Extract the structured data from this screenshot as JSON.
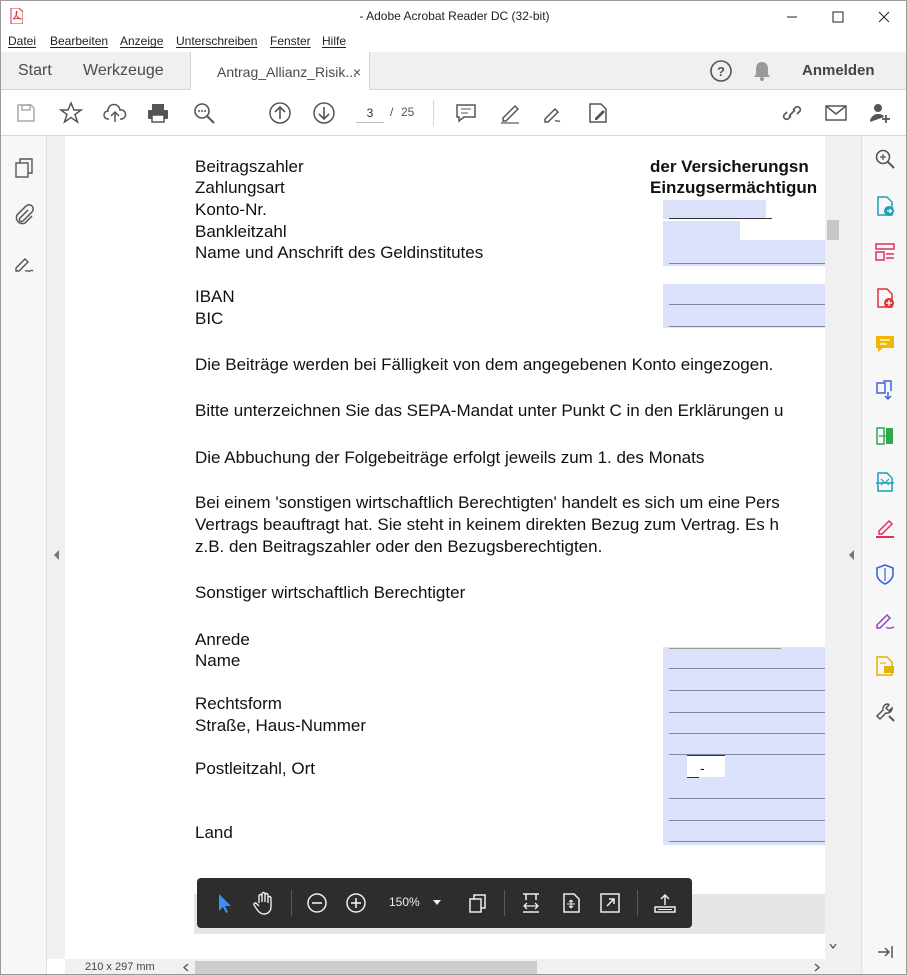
{
  "window": {
    "title": "- Adobe Acrobat Reader DC (32-bit)"
  },
  "menu": [
    "Datei",
    "Bearbeiten",
    "Anzeige",
    "Unterschreiben",
    "Fenster",
    "Hilfe"
  ],
  "tabs": {
    "start": "Start",
    "tools": "Werkzeuge",
    "document": "Antrag_Allianz_Risik...",
    "close": "×"
  },
  "header": {
    "signin": "Anmelden"
  },
  "toolbar": {
    "page_current": "3",
    "page_separator": "/",
    "page_total": "25"
  },
  "document": {
    "label_payer": "Beitragszahler",
    "label_payment_method": "Zahlungsart",
    "label_account": "Konto-Nr.",
    "label_bank_code": "Bankleitzahl",
    "label_bank_name": "Name und Anschrift des Geldinstitutes",
    "label_iban": "IBAN",
    "label_bic": "BIC",
    "value_payer": "der Versicherungsn",
    "value_payment_method": "Einzugsermächtigun",
    "para_debit": "Die Beiträge werden bei Fälligkeit von dem angegebenen Konto eingezogen.",
    "para_sepa": "Bitte unterzeichnen Sie das SEPA-Mandat unter Punkt C in den Erklärungen u",
    "para_followup": "Die Abbuchung der Folgebeiträge erfolgt jeweils zum 1. des Monats",
    "para_other_1": "Bei einem 'sonstigen wirtschaftlich Berechtigten' handelt es sich um eine Pers",
    "para_other_2": "Vertrags beauftragt hat. Sie steht in keinem direkten Bezug zum Vertrag. Es h",
    "para_other_3": "z.B. den Beitragszahler oder den Bezugsberechtigten.",
    "heading_other": "Sonstiger wirtschaftlich Berechtigter",
    "label_salutation": "Anrede",
    "label_name": "Name",
    "label_legal_form": "Rechtsform",
    "label_street": "Straße, Haus-Nummer",
    "label_postcode": "Postleitzahl, Ort",
    "label_country": "Land",
    "postcode_dash": "-"
  },
  "floatbar": {
    "zoom": "150%"
  },
  "status": {
    "page_size": "210 x 297 mm"
  },
  "colors": {
    "field_fill": "#dbe1fb",
    "toolbar_bg": "#2d2d2d",
    "accent_red": "#d6303a"
  }
}
